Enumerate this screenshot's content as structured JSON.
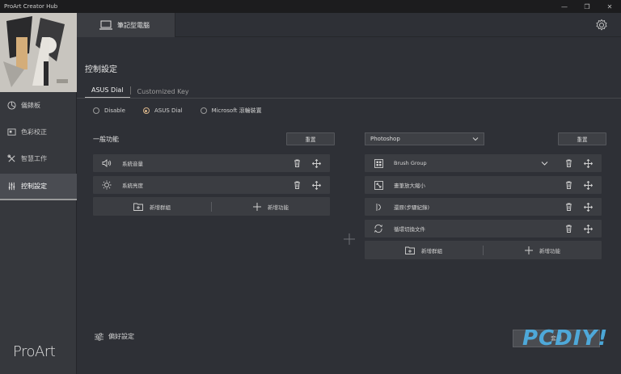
{
  "window": {
    "title": "ProArt Creator Hub",
    "minimize": "—",
    "maximize": "❐",
    "close": "✕"
  },
  "device_tab": {
    "label": "筆記型電腦"
  },
  "sidebar": {
    "brand": "ProArt",
    "items": [
      {
        "label": "儀錶板",
        "icon": "dashboard-icon"
      },
      {
        "label": "色彩校正",
        "icon": "color-icon"
      },
      {
        "label": "智慧工作",
        "icon": "tools-icon"
      },
      {
        "label": "控制設定",
        "icon": "sliders-icon",
        "active": true
      }
    ]
  },
  "main": {
    "title": "控制設定",
    "tabs": [
      {
        "label": "ASUS Dial",
        "active": true
      },
      {
        "label": "Customized Key",
        "active": false
      }
    ],
    "radios": [
      {
        "label": "Disable",
        "selected": false
      },
      {
        "label": "ASUS Dial",
        "selected": true
      },
      {
        "label": "Microsoft 滾輪裝置",
        "selected": false
      }
    ],
    "general": {
      "label": "一般功能",
      "reset_label": "重置",
      "items": [
        {
          "label": "系統音量",
          "icon": "volume-icon"
        },
        {
          "label": "系統亮度",
          "icon": "brightness-icon"
        }
      ],
      "add_group": "新增群組",
      "add_function": "新增功能"
    },
    "app": {
      "selected": "Photoshop",
      "reset_label": "重置",
      "items": [
        {
          "label": "Brush Group",
          "icon": "grid-icon",
          "expandable": true
        },
        {
          "label": "畫筆放大縮小",
          "icon": "resize-icon"
        },
        {
          "label": "還原(步驟紀錄)",
          "icon": "undo-icon"
        },
        {
          "label": "循環切換文件",
          "icon": "cycle-icon"
        }
      ],
      "add_group": "新增群組",
      "add_function": "新增功能"
    },
    "preferences_label": "偏好設定",
    "apply_label": "套用",
    "watermark": "PCDIY!"
  },
  "colors": {
    "accent": "#d8b48a",
    "background": "#2e3036",
    "panel": "#3b3d42",
    "watermark": "#4fb3e8"
  }
}
